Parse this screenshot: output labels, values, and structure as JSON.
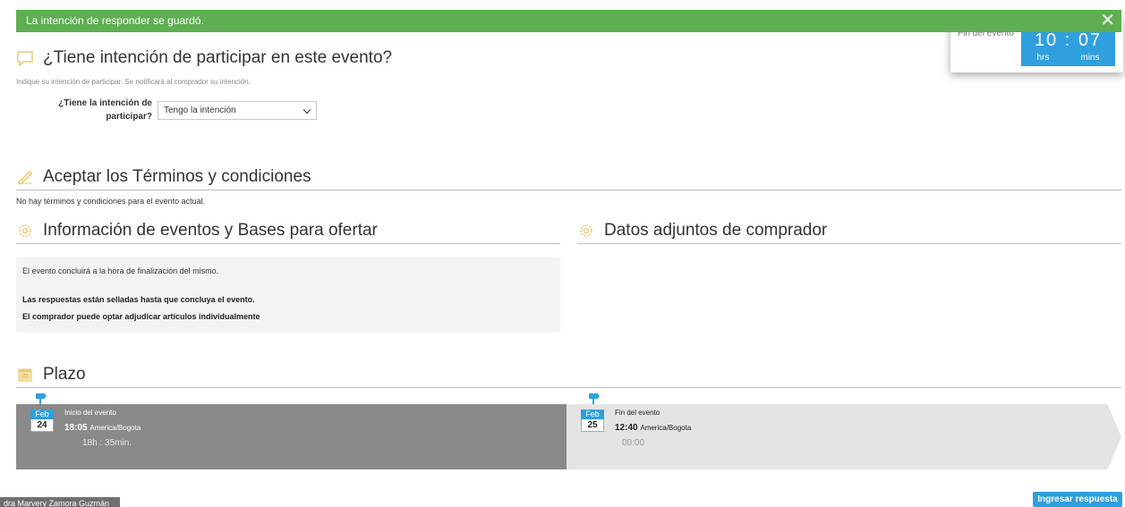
{
  "notification": {
    "message": "La intención de responder se guardó.",
    "close_symbol": "✕",
    "color": "#5fae52"
  },
  "timer": {
    "label": "Fin del evento",
    "digits": "10 : 07",
    "unit_hours": "hrs",
    "unit_mins": "mins",
    "color": "#2f9fde"
  },
  "intent_section": {
    "title": "¿Tiene intención de participar en este evento?",
    "hint": "Indique su intención de participar. Se notificará al comprador su intención.",
    "field_label_line1": "¿Tiene la intención de",
    "field_label_line2": "participar?",
    "field_value": "Tengo la intención"
  },
  "terms_section": {
    "title": "Aceptar los Términos y condiciones",
    "text": "No hay términos y condiciones para el evento actual."
  },
  "info_section": {
    "title": "Información de eventos y Bases para ofertar",
    "line1": "El evento concluirá a la hora de finalización del mismo.",
    "line2": "Las respuestas están selladas hasta que concluya el evento.",
    "line3": "El comprador puede optar adjudicar artículos individualmente"
  },
  "attachments_section": {
    "title": "Datos adjuntos de comprador"
  },
  "deadline_section": {
    "title": "Plazo",
    "start": {
      "month": "Feb",
      "day": "24",
      "label": "Inicio del evento",
      "time": "18:05",
      "tz": "America/Bogota",
      "remaining": "18h : 35min."
    },
    "end": {
      "month": "Feb",
      "day": "25",
      "label": "Fin del evento",
      "time": "12:40",
      "tz": "America/Bogota",
      "remaining": "00:00"
    }
  },
  "footer": {
    "user_name": "dra Marvery Zamora Guzmán",
    "submit_label": "Ingresar respuesta"
  }
}
